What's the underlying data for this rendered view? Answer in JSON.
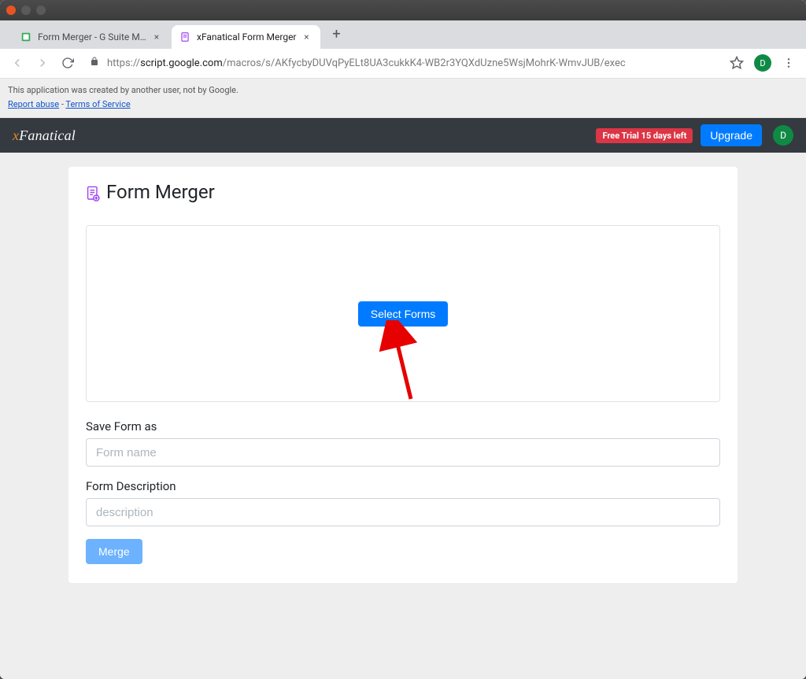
{
  "os": {
    "window_buttons": [
      "close",
      "minimize",
      "maximize"
    ]
  },
  "browser": {
    "tabs": [
      {
        "title": "Form Merger - G Suite Marketpl…",
        "active": false,
        "favicon_color": "#34a853"
      },
      {
        "title": "xFanatical Form Merger",
        "active": true,
        "favicon_color": "#a142f4"
      }
    ],
    "newtab_symbol": "+",
    "nav": {
      "back_disabled_label": "←",
      "forward_disabled_label": "→",
      "reload_label": "⟳",
      "lock_label": "🔒",
      "star_label": "☆",
      "menu_label": "⋮"
    },
    "url_host": "script.google.com",
    "url_path": "/macros/s/AKfycbyDUVqPyELt8UA3cukkK4-WB2r3YQXdUzne5WsjMohrK-WmvJUB/exec",
    "avatar_letter": "D"
  },
  "disclaimer": {
    "text": "This application was created by another user, not by Google.",
    "report_abuse_label": "Report abuse",
    "separator": " - ",
    "tos_label": "Terms of Service"
  },
  "app_header": {
    "brand_x": "x",
    "brand_rest": "Fanatical",
    "trial_badge": "Free Trial 15 days left",
    "upgrade_label": "Upgrade",
    "avatar_letter": "D"
  },
  "page": {
    "title": "Form Merger",
    "select_forms_label": "Select Forms",
    "save_form_as_label": "Save Form as",
    "form_name_placeholder": "Form name",
    "form_description_label": "Form Description",
    "form_description_placeholder": "description",
    "merge_label": "Merge"
  },
  "colors": {
    "primary": "#007bff",
    "danger": "#dc3545",
    "dark": "#343a40",
    "page_bg": "#eeeeee"
  }
}
